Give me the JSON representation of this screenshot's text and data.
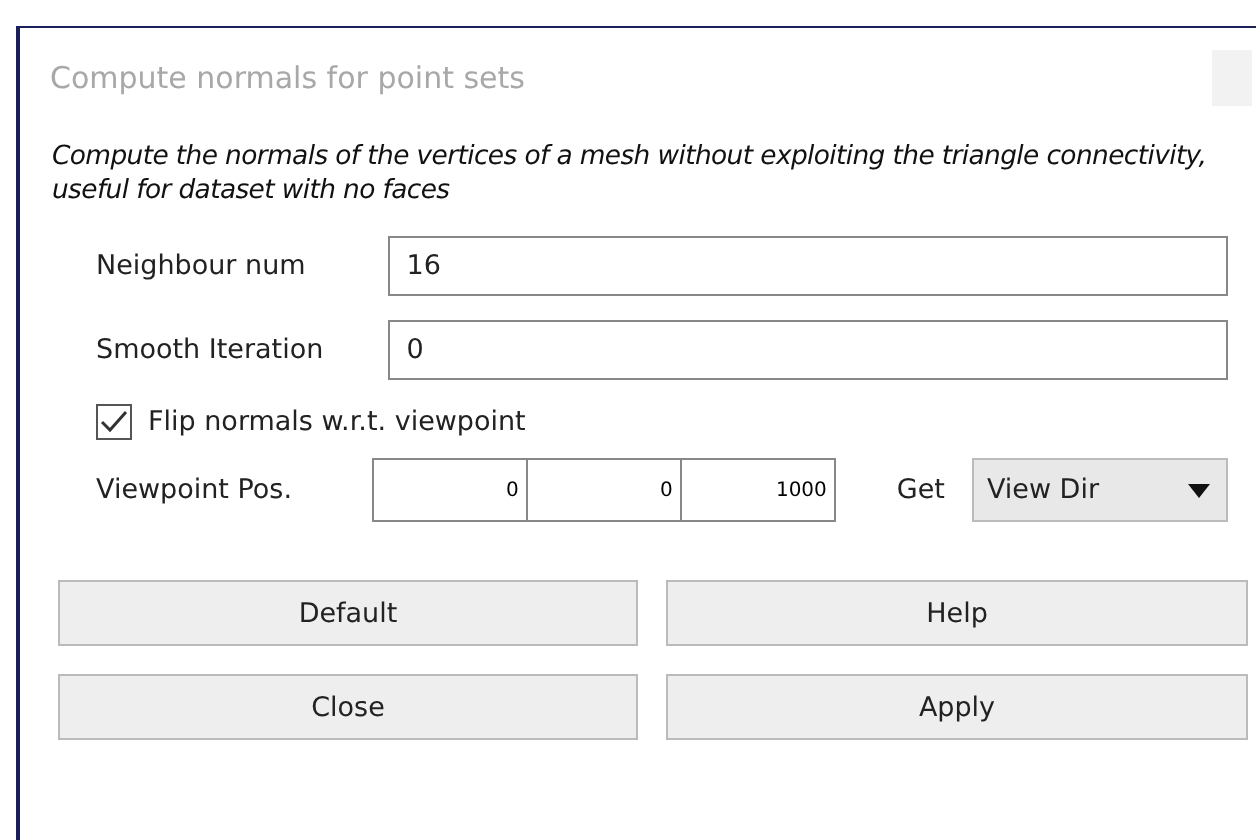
{
  "window": {
    "title": "Compute normals for point sets"
  },
  "description": "Compute the normals of the vertices of a mesh without exploiting the triangle connectivity, useful for dataset with no faces",
  "fields": [
    {
      "label": "Neighbour num",
      "value": "16"
    },
    {
      "label": "Smooth Iteration",
      "value": "0"
    }
  ],
  "flip": {
    "label": "Flip normals w.r.t. viewpoint",
    "checked": true
  },
  "viewpoint": {
    "label": "Viewpoint Pos.",
    "values": [
      "0",
      "0",
      "1000"
    ],
    "get_label": "Get",
    "combo": "View Dir"
  },
  "buttons": [
    "Default",
    "Help",
    "Close",
    "Apply"
  ]
}
